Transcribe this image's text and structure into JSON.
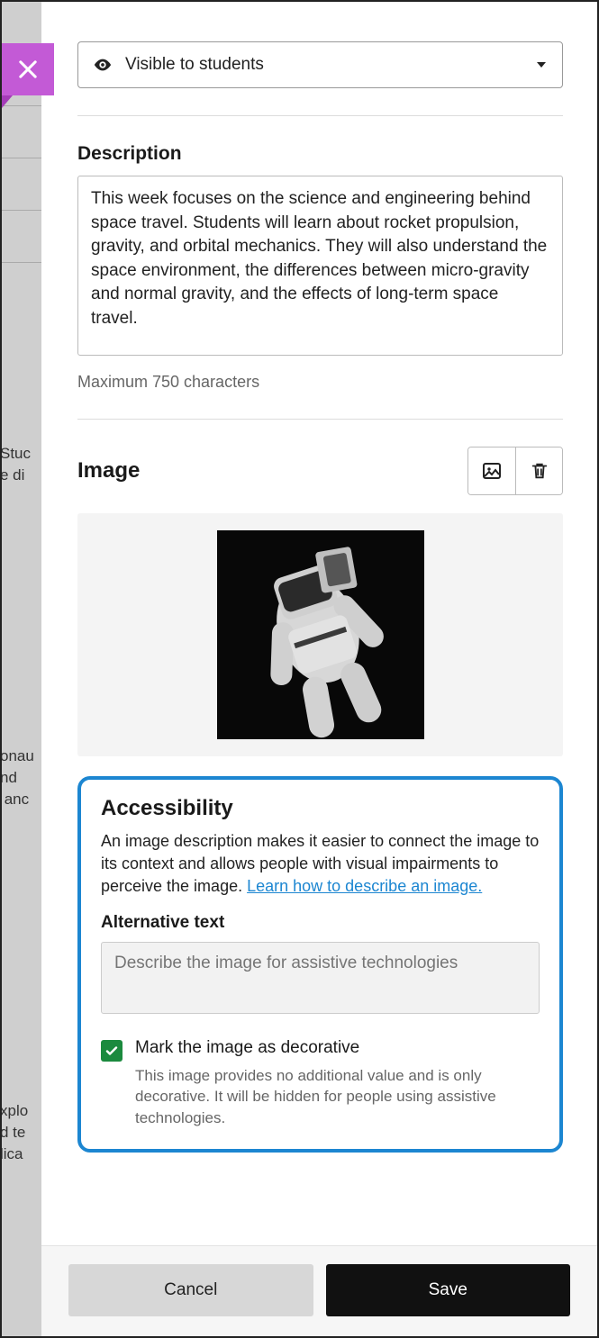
{
  "visibility": {
    "selected": "Visible to students"
  },
  "description": {
    "label": "Description",
    "value": "This week focuses on the science and engineering behind space travel. Students will learn about rocket propulsion, gravity, and orbital mechanics. They will also understand the space environment, the differences between micro-gravity and normal gravity, and the effects of long-term space travel.",
    "hint": "Maximum 750 characters"
  },
  "image": {
    "heading": "Image"
  },
  "accessibility": {
    "heading": "Accessibility",
    "desc_prefix": "An image description makes it easier to connect the image to its context and allows people with visual impairments to perceive the image. ",
    "link_text": "Learn how to describe an image.",
    "alt_label": "Alternative text",
    "alt_placeholder": "Describe the image for assistive technologies",
    "alt_value": "",
    "decorative_checked": true,
    "decorative_label": "Mark the image as decorative",
    "decorative_help": "This image provides no additional value and is only decorative. It will be hidden for people using assistive technologies."
  },
  "footer": {
    "cancel": "Cancel",
    "save": "Save"
  },
  "background_snippets": {
    "a": "Stuc\ne di",
    "b": "onau\nnd\n anc",
    "c": "xplo\nd te\nlica"
  }
}
